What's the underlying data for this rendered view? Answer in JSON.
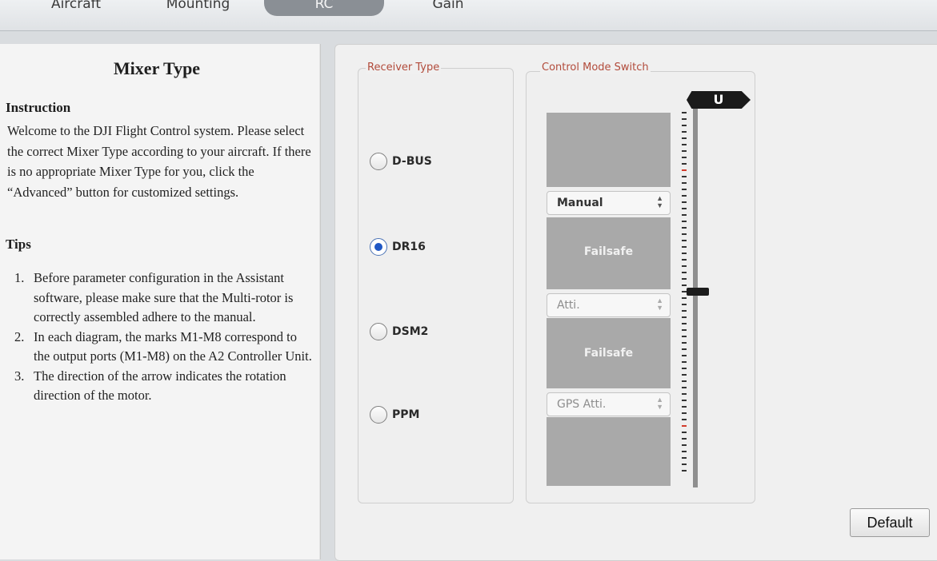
{
  "tabs": [
    {
      "label": "Aircraft",
      "active": false
    },
    {
      "label": "Mounting",
      "active": false
    },
    {
      "label": "RC",
      "active": true
    },
    {
      "label": "Gain",
      "active": false
    }
  ],
  "left_panel": {
    "title": "Mixer Type",
    "instruction_heading": "Instruction",
    "instruction_text": "Welcome to the DJI Flight Control system. Please select the correct Mixer Type according to your aircraft. If there is no appropriate Mixer Type for you, click the “Advanced” button for customized settings.",
    "tips_heading": "Tips",
    "tips": [
      {
        "num": "1.",
        "text": "Before parameter configuration in the Assistant software, please make sure that the Multi-rotor is correctly assembled adhere to the manual."
      },
      {
        "num": "2.",
        "text": "In each diagram, the marks M1-M8 correspond to the output ports (M1-M8) on the A2 Controller Unit."
      },
      {
        "num": "3.",
        "text": "The direction of the arrow indicates the rotation direction of the motor."
      }
    ]
  },
  "receiver": {
    "group_label": "Receiver Type",
    "options": [
      {
        "label": "D-BUS",
        "checked": false
      },
      {
        "label": "DR16",
        "checked": true
      },
      {
        "label": "DSM2",
        "checked": false
      },
      {
        "label": "PPM",
        "checked": false
      }
    ]
  },
  "control_mode": {
    "group_label": "Control Mode Switch",
    "selects": [
      {
        "value": "Manual",
        "enabled": true
      },
      {
        "value": "Atti.",
        "enabled": false
      },
      {
        "value": "GPS Atti.",
        "enabled": false
      }
    ],
    "failsafe_labels": [
      "Failsafe",
      "Failsafe"
    ],
    "channel_badge": "U",
    "slider_value_fraction": 0.5
  },
  "buttons": {
    "default_label": "Default"
  },
  "colors": {
    "accent_red": "#d23b2b",
    "radio_blue": "#1f57c4",
    "label_red": "#b24b3b"
  }
}
